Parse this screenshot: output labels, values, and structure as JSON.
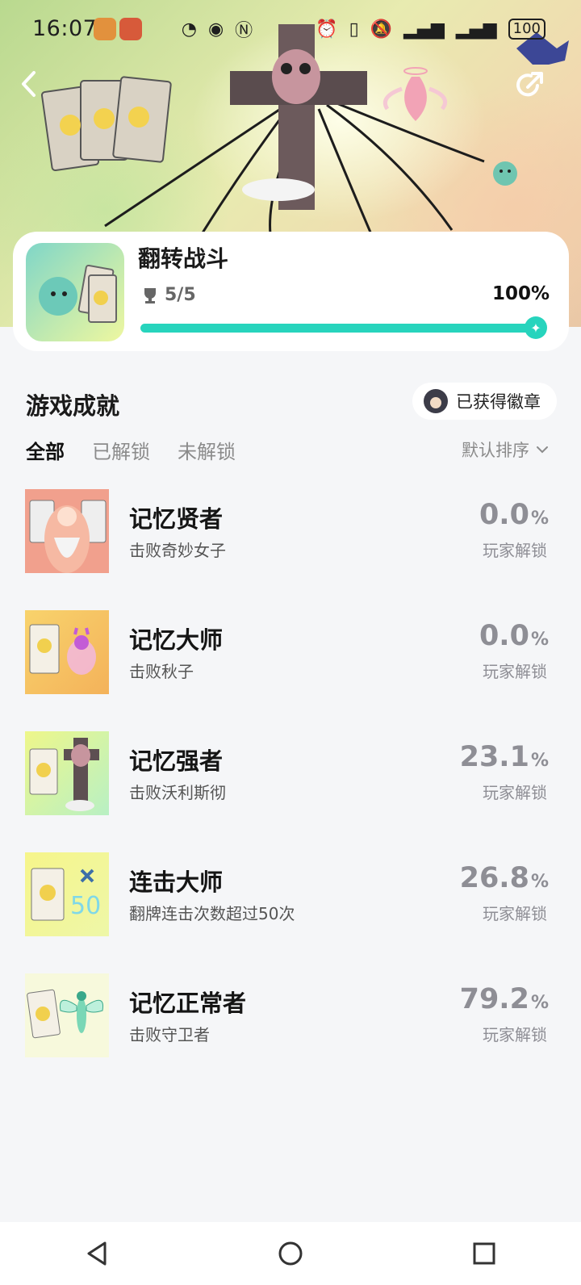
{
  "status_bar": {
    "time": "16:07",
    "battery": "100"
  },
  "game": {
    "title": "翻转战斗",
    "trophy_count": "5/5",
    "progress_percent_label": "100%",
    "progress": 1.0
  },
  "section": {
    "title": "游戏成就",
    "badge_button_label": "已获得徽章"
  },
  "tabs": [
    {
      "label": "全部",
      "active": true
    },
    {
      "label": "已解锁",
      "active": false
    },
    {
      "label": "未解锁",
      "active": false
    }
  ],
  "sort_label": "默认排序",
  "achievements": [
    {
      "name": "记忆贤者",
      "desc": "击败奇妙女子",
      "pct": "0.0",
      "unit": "%",
      "sub": "玩家解锁",
      "thumb_bg": "#f3a090"
    },
    {
      "name": "记忆大师",
      "desc": "击败秋子",
      "pct": "0.0",
      "unit": "%",
      "sub": "玩家解锁",
      "thumb_bg": "#f6c870"
    },
    {
      "name": "记忆强者",
      "desc": "击败沃利斯彻",
      "pct": "23.1",
      "unit": "%",
      "sub": "玩家解锁",
      "thumb_bg": "#e8f690"
    },
    {
      "name": "连击大师",
      "desc": "翻牌连击次数超过50次",
      "pct": "26.8",
      "unit": "%",
      "sub": "玩家解锁",
      "thumb_bg": "#f4f48a"
    },
    {
      "name": "记忆正常者",
      "desc": "击败守卫者",
      "pct": "79.2",
      "unit": "%",
      "sub": "玩家解锁",
      "thumb_bg": "#f6f9d8"
    }
  ],
  "colors": {
    "accent": "#27d4bd",
    "page_bg": "#f5f6f8"
  }
}
